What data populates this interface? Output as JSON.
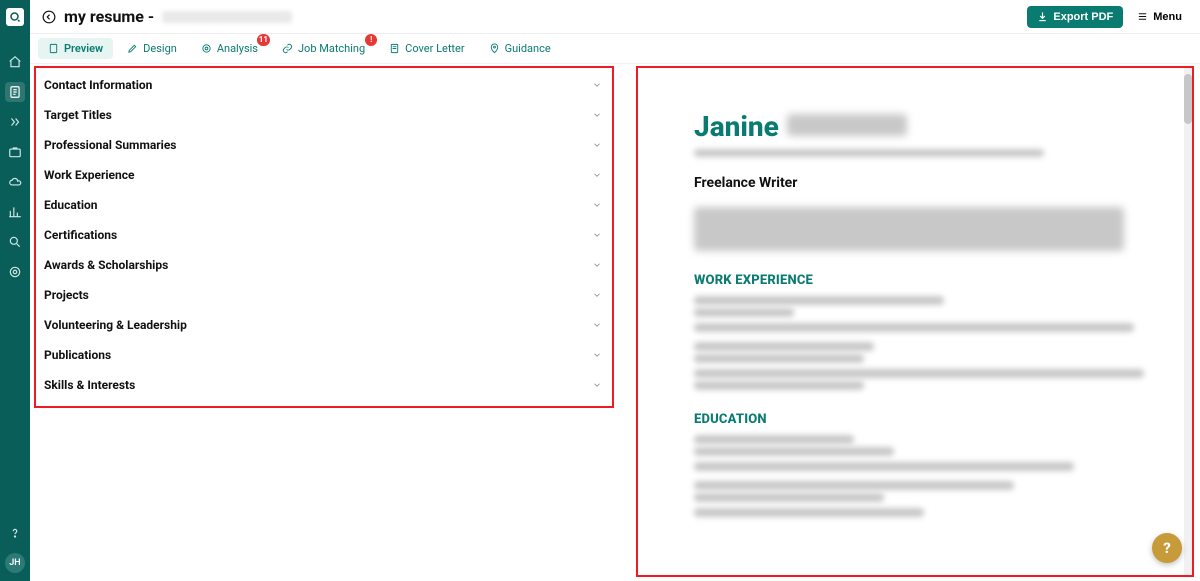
{
  "header": {
    "title_prefix": "my resume -",
    "export_label": "Export PDF",
    "menu_label": "Menu"
  },
  "tabs": [
    {
      "id": "preview",
      "label": "Preview",
      "active": true
    },
    {
      "id": "design",
      "label": "Design",
      "active": false
    },
    {
      "id": "analysis",
      "label": "Analysis",
      "active": false,
      "badge": "11"
    },
    {
      "id": "jobmatching",
      "label": "Job Matching",
      "active": false,
      "badge": "!"
    },
    {
      "id": "coverletter",
      "label": "Cover Letter",
      "active": false
    },
    {
      "id": "guidance",
      "label": "Guidance",
      "active": false
    }
  ],
  "sections": [
    {
      "label": "Contact Information"
    },
    {
      "label": "Target Titles"
    },
    {
      "label": "Professional Summaries"
    },
    {
      "label": "Work Experience"
    },
    {
      "label": "Education"
    },
    {
      "label": "Certifications"
    },
    {
      "label": "Awards & Scholarships"
    },
    {
      "label": "Projects"
    },
    {
      "label": "Volunteering & Leadership"
    },
    {
      "label": "Publications"
    },
    {
      "label": "Skills & Interests"
    }
  ],
  "sidebar": {
    "avatar_initials": "JH"
  },
  "resume": {
    "first_name": "Janine",
    "role": "Freelance Writer",
    "section_work": "WORK EXPERIENCE",
    "section_edu": "EDUCATION"
  },
  "colors": {
    "brand": "#0a5e5a",
    "accent": "#0a7b71",
    "highlight": "#ed1c24",
    "fab": "#c79a3a"
  }
}
